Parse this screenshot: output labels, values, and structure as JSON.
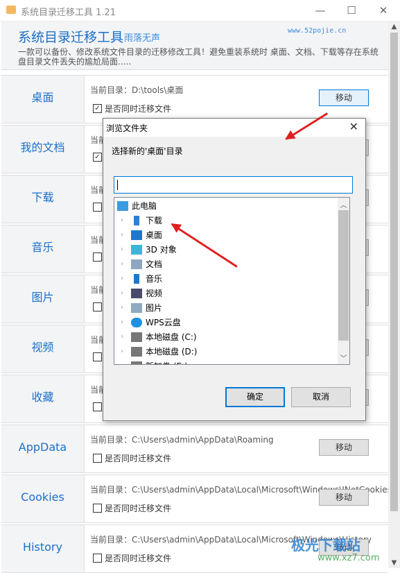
{
  "window": {
    "title": "系统目录迁移工具 1.21",
    "controls": {
      "minimize": "—",
      "maximize": "☐",
      "close": "✕"
    }
  },
  "header": {
    "title": "系统目录迁移工具",
    "author": "雨落无声",
    "site": "www.52pojie.cn",
    "description": "一款可以备份、修改系统文件目录的迁移修改工具！避免重装系统时 桌面、文档、下载等存在系统盘目录文件丢失的尴尬局面....."
  },
  "rows": [
    {
      "label": "桌面",
      "dir": "当前目录：D:\\tools\\桌面",
      "checkbox": "是否同时迁移文件",
      "checked": true,
      "button": "移动"
    },
    {
      "label": "我的文档",
      "dir": "当前",
      "checkbox": "",
      "checked": true,
      "button": ""
    },
    {
      "label": "下载",
      "dir": "当前",
      "checkbox": "",
      "checked": false,
      "button": ""
    },
    {
      "label": "音乐",
      "dir": "当前",
      "checkbox": "",
      "checked": false,
      "button": ""
    },
    {
      "label": "图片",
      "dir": "当前",
      "checkbox": "",
      "checked": false,
      "button": ""
    },
    {
      "label": "视频",
      "dir": "当前",
      "checkbox": "",
      "checked": false,
      "button": ""
    },
    {
      "label": "收藏",
      "dir": "当前",
      "checkbox": "",
      "checked": false,
      "button": ""
    },
    {
      "label": "AppData",
      "dir": "当前目录：C:\\Users\\admin\\AppData\\Roaming",
      "checkbox": "是否同时迁移文件",
      "checked": false,
      "button": "移动"
    },
    {
      "label": "Cookies",
      "dir": "当前目录：C:\\Users\\admin\\AppData\\Local\\Microsoft\\Windows\\INetCookies",
      "checkbox": "是否同时迁移文件",
      "checked": false,
      "button": "移动"
    },
    {
      "label": "History",
      "dir": "当前目录：C:\\Users\\admin\\AppData\\Local\\Microsoft\\Windows\\History",
      "checkbox": "是否同时迁移文件",
      "checked": false,
      "button": "移动"
    }
  ],
  "dialog": {
    "title": "浏览文件夹",
    "close": "✕",
    "prompt": "选择新的'桌面'目录",
    "input_value": "",
    "tree": [
      {
        "label": "此电脑",
        "icon": "computer-icon",
        "color": "#3a9be0",
        "root": true
      },
      {
        "label": "下载",
        "icon": "download-icon",
        "color": "#2d7fd6"
      },
      {
        "label": "桌面",
        "icon": "desktop-icon",
        "color": "#1a78d0"
      },
      {
        "label": "3D 对象",
        "icon": "cube-icon",
        "color": "#3ab6d8"
      },
      {
        "label": "文档",
        "icon": "document-icon",
        "color": "#8ea6c0"
      },
      {
        "label": "音乐",
        "icon": "music-icon",
        "color": "#1a78d0"
      },
      {
        "label": "视频",
        "icon": "video-icon",
        "color": "#4a4a6a"
      },
      {
        "label": "图片",
        "icon": "picture-icon",
        "color": "#8fa9bf"
      },
      {
        "label": "WPS云盘",
        "icon": "cloud-icon",
        "color": "#1e90e0"
      },
      {
        "label": "本地磁盘 (C:)",
        "icon": "drive-c-icon",
        "color": "#777"
      },
      {
        "label": "本地磁盘 (D:)",
        "icon": "drive-d-icon",
        "color": "#777"
      },
      {
        "label": "新加卷 (E:)",
        "icon": "drive-e-icon",
        "color": "#777"
      }
    ],
    "ok": "确定",
    "cancel": "取消"
  },
  "watermark": {
    "text": "极光下载站",
    "site": "www.xz7.com"
  }
}
